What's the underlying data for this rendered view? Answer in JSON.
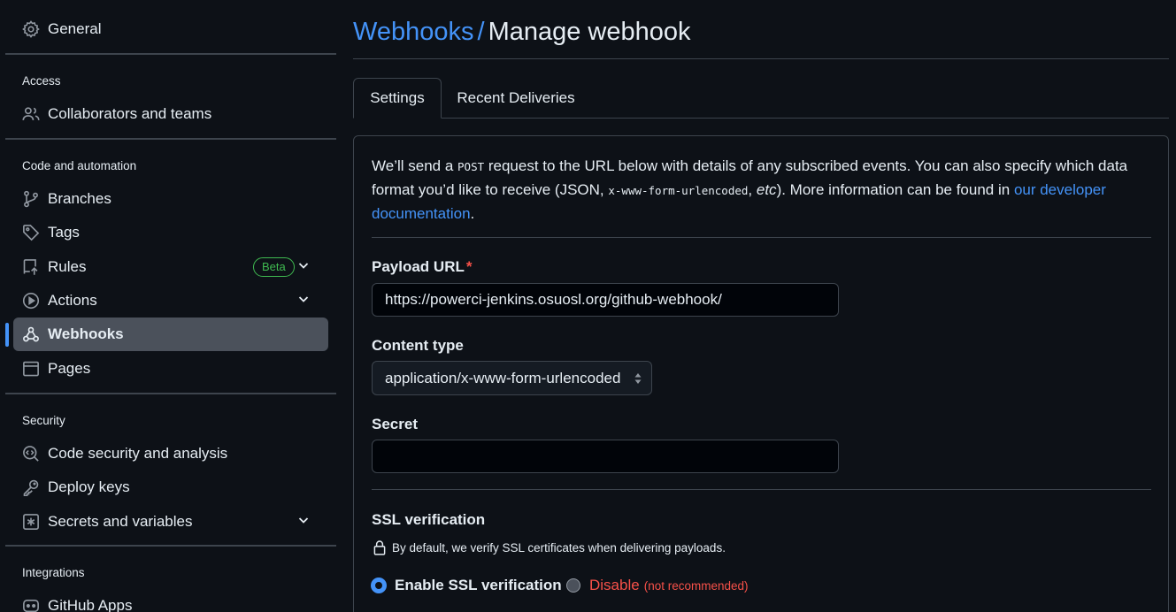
{
  "sidebar": {
    "general": "General",
    "access_heading": "Access",
    "collaborators": "Collaborators and teams",
    "code_heading": "Code and automation",
    "branches": "Branches",
    "tags": "Tags",
    "rules": "Rules",
    "rules_badge": "Beta",
    "actions": "Actions",
    "webhooks": "Webhooks",
    "pages": "Pages",
    "security_heading": "Security",
    "code_security": "Code security and analysis",
    "deploy_keys": "Deploy keys",
    "secrets": "Secrets and variables",
    "integrations_heading": "Integrations",
    "github_apps": "GitHub Apps"
  },
  "header": {
    "breadcrumb": "Webhooks",
    "separator": "/",
    "title": "Manage webhook"
  },
  "tabs": {
    "settings": "Settings",
    "recent": "Recent Deliveries"
  },
  "intro": {
    "p1": "We’ll send a ",
    "code1": "POST",
    "p2": " request to the URL below with details of any subscribed events. You can also specify which data format you’d like to receive (JSON, ",
    "code2": "x-www-form-urlencoded",
    "p3": ", ",
    "etc": "etc",
    "p4": "). More information can be found in ",
    "link": "our developer documentation",
    "p5": "."
  },
  "form": {
    "payload_label": "Payload URL",
    "required_mark": "*",
    "payload_value": "https://powerci-jenkins.osuosl.org/github-webhook/",
    "content_label": "Content type",
    "content_value": "application/x-www-form-urlencoded",
    "secret_label": "Secret",
    "secret_value": "",
    "ssl_heading": "SSL verification",
    "ssl_note": "By default, we verify SSL certificates when delivering payloads.",
    "ssl_enable": "Enable SSL verification",
    "ssl_disable": "Disable",
    "ssl_disable_note": "(not recommended)"
  },
  "colors": {
    "background": "#0d1117",
    "accent": "#4493f8",
    "border": "#3d444d",
    "success": "#3fb950",
    "danger": "#f85149"
  }
}
